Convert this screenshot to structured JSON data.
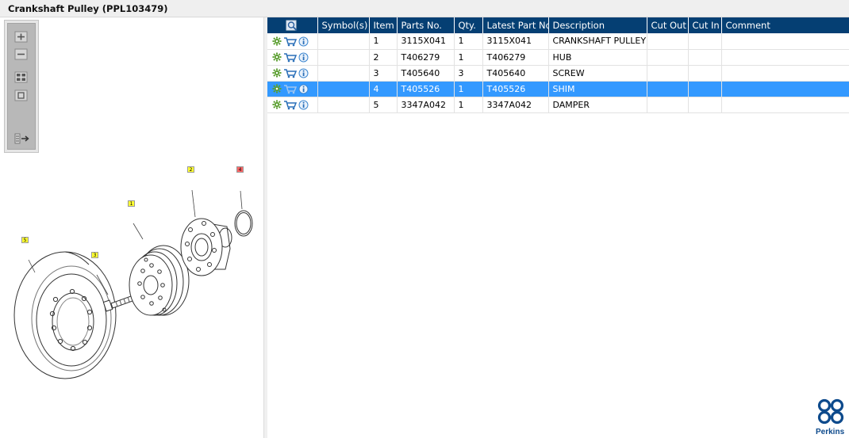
{
  "window": {
    "title": "Crankshaft Pulley (PPL103479)"
  },
  "toolbar": {
    "buttons": [
      {
        "name": "zoom-in-icon"
      },
      {
        "name": "zoom-out-icon"
      },
      {
        "name": "fit-page-icon"
      },
      {
        "name": "actual-size-icon"
      },
      {
        "name": "list-export-icon"
      }
    ]
  },
  "drawing": {
    "callouts": [
      "5",
      "3",
      "1",
      "2",
      "4"
    ],
    "callout_color": "#ffff33",
    "callout_alt_color": "#ff6666"
  },
  "table": {
    "columns": [
      "",
      "Symbol(s)",
      "Item",
      "Parts No.",
      "Qty.",
      "Latest Part No.",
      "Description",
      "Cut Out",
      "Cut In",
      "Comment"
    ],
    "rows": [
      {
        "item": "1",
        "parts_no": "3115X041",
        "qty": "1",
        "latest_part_no": "3115X041",
        "description": "CRANKSHAFT PULLEY",
        "symbols": "",
        "cut_out": "",
        "cut_in": "",
        "comment": ""
      },
      {
        "item": "2",
        "parts_no": "T406279",
        "qty": "1",
        "latest_part_no": "T406279",
        "description": "HUB",
        "symbols": "",
        "cut_out": "",
        "cut_in": "",
        "comment": ""
      },
      {
        "item": "3",
        "parts_no": "T405640",
        "qty": "3",
        "latest_part_no": "T405640",
        "description": "SCREW",
        "symbols": "",
        "cut_out": "",
        "cut_in": "",
        "comment": ""
      },
      {
        "item": "4",
        "parts_no": "T405526",
        "qty": "1",
        "latest_part_no": "T405526",
        "description": "SHIM",
        "symbols": "",
        "cut_out": "",
        "cut_in": "",
        "comment": ""
      },
      {
        "item": "5",
        "parts_no": "3347A042",
        "qty": "1",
        "latest_part_no": "3347A042",
        "description": "DAMPER",
        "symbols": "",
        "cut_out": "",
        "cut_in": "",
        "comment": ""
      }
    ],
    "selected_item": "4",
    "header_color": "#053f73",
    "selected_color": "#3399ff"
  },
  "brand": {
    "name": "Perkins",
    "color": "#0d4a8c"
  }
}
